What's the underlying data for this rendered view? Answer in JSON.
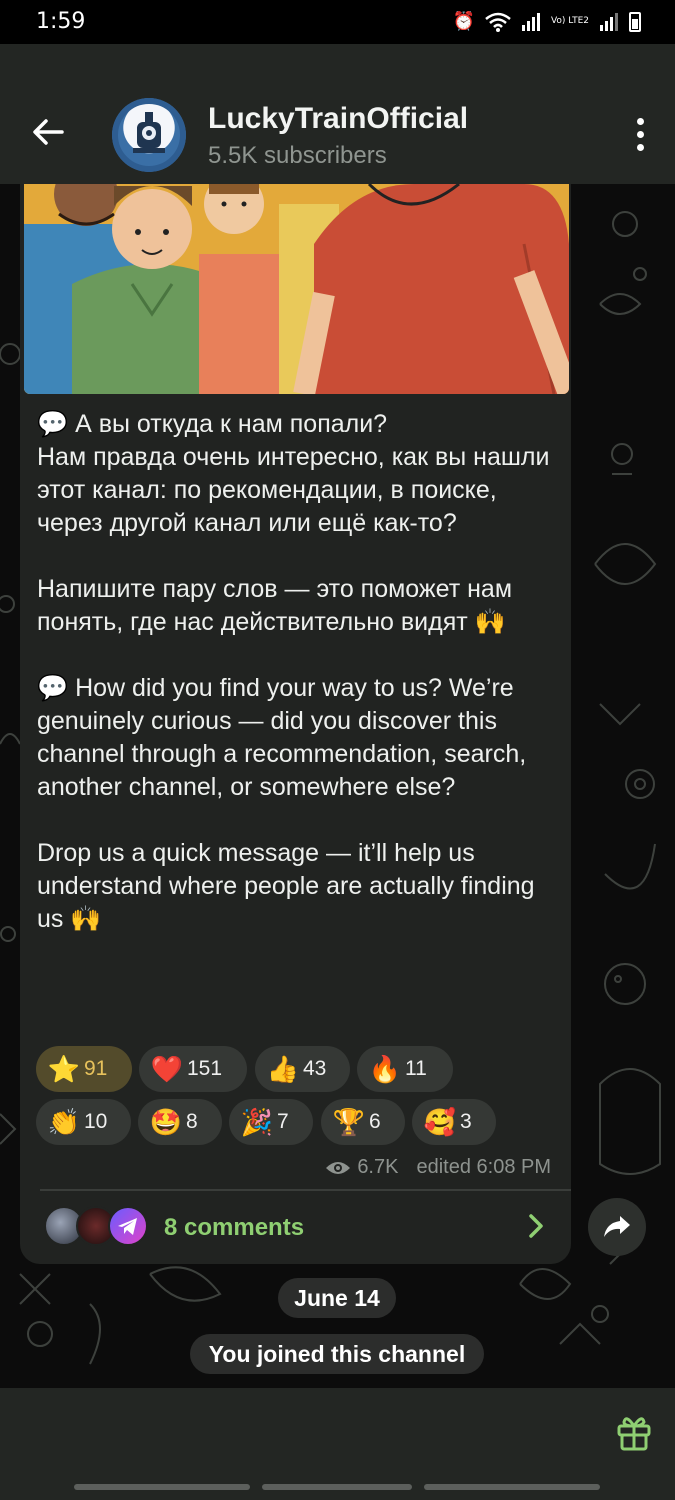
{
  "status_bar": {
    "time": "1:59",
    "icons": [
      "alarm-icon",
      "wifi-icon",
      "signal-icon",
      "volte-icon",
      "signal-icon",
      "battery-icon"
    ],
    "volte_label": "Vo) LTE2"
  },
  "header": {
    "back_icon": "arrow-left-icon",
    "channel_name": "LuckyTrainOfficial",
    "subscribers": "5.5K subscribers",
    "menu_icon": "more-vertical-icon"
  },
  "post": {
    "image_icon": "people-illustration",
    "text": "💬 А вы откуда к нам попали?\nНам правда очень интересно, как вы нашли этот канал: по рекомендации, в поиске, через другой канал или ещё как-то?\n\nНапишите пару слов — это поможет нам понять, где нас действительно видят 🙌\n\n💬 How did you find your way to us? We’re genuinely curious — did you discover this channel through a recommendation, search, another channel, or somewhere else?\n\nDrop us a quick message — it’ll help us understand where people are actually finding us 🙌",
    "reactions": [
      {
        "icon": "⭐",
        "count": "91",
        "active": true
      },
      {
        "icon": "❤️",
        "count": "151",
        "active": false
      },
      {
        "icon": "👍",
        "count": "43",
        "active": false
      },
      {
        "icon": "🔥",
        "count": "11",
        "active": false
      },
      {
        "icon": "👏",
        "count": "10",
        "active": false
      },
      {
        "icon": "🤩",
        "count": "8",
        "active": false
      },
      {
        "icon": "🎉",
        "count": "7",
        "active": false
      },
      {
        "icon": "🏆",
        "count": "6",
        "active": false
      },
      {
        "icon": "🥰",
        "count": "3",
        "active": false
      }
    ],
    "views": "6.7K",
    "edited": "edited 6:08 PM",
    "comments": "8 comments"
  },
  "chat": {
    "date_label": "June 14",
    "service_message": "You joined this channel"
  },
  "colors": {
    "header_bg": "#232623",
    "bubble_bg": "#212321",
    "accent_green": "#8fcf72",
    "active_reaction": "#e7c25c"
  }
}
